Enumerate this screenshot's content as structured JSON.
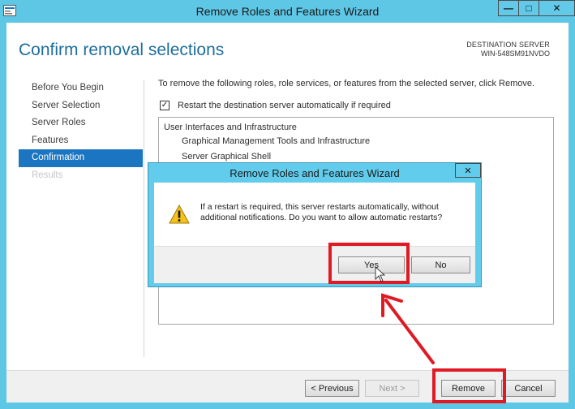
{
  "window": {
    "title": "Remove Roles and Features Wizard",
    "min_glyph": "—",
    "max_glyph": "□",
    "close_glyph": "✕"
  },
  "page": {
    "title": "Confirm removal selections",
    "destination_label": "DESTINATION SERVER",
    "destination_server": "WIN-548SM91NVDO"
  },
  "nav": {
    "items": [
      {
        "label": "Before You Begin",
        "state": "normal"
      },
      {
        "label": "Server Selection",
        "state": "normal"
      },
      {
        "label": "Server Roles",
        "state": "normal"
      },
      {
        "label": "Features",
        "state": "normal"
      },
      {
        "label": "Confirmation",
        "state": "active"
      },
      {
        "label": "Results",
        "state": "disabled"
      }
    ]
  },
  "main": {
    "instruction": "To remove the following roles, role services, or features from the selected server, click Remove.",
    "restart_checkbox": {
      "checked": true,
      "glyph": "✓",
      "label": "Restart the destination server automatically if required"
    },
    "selections": [
      {
        "text": "User Interfaces and Infrastructure",
        "level": 0
      },
      {
        "text": "Graphical Management Tools and Infrastructure",
        "level": 1
      },
      {
        "text": "Server Graphical Shell",
        "level": 1
      }
    ]
  },
  "footer": {
    "previous": "< Previous",
    "next": "Next >",
    "remove": "Remove",
    "cancel": "Cancel"
  },
  "dialog": {
    "title": "Remove Roles and Features Wizard",
    "close_glyph": "✕",
    "message": "If a restart is required, this server restarts automatically, without additional notifications. Do you want to allow automatic restarts?",
    "yes": "Yes",
    "no": "No"
  },
  "colors": {
    "window_frame": "#5ec7e6",
    "accent_title": "#1e6e9c",
    "nav_active": "#1c75c1",
    "annotation": "#e01a24",
    "warning": "#f4c21b"
  }
}
